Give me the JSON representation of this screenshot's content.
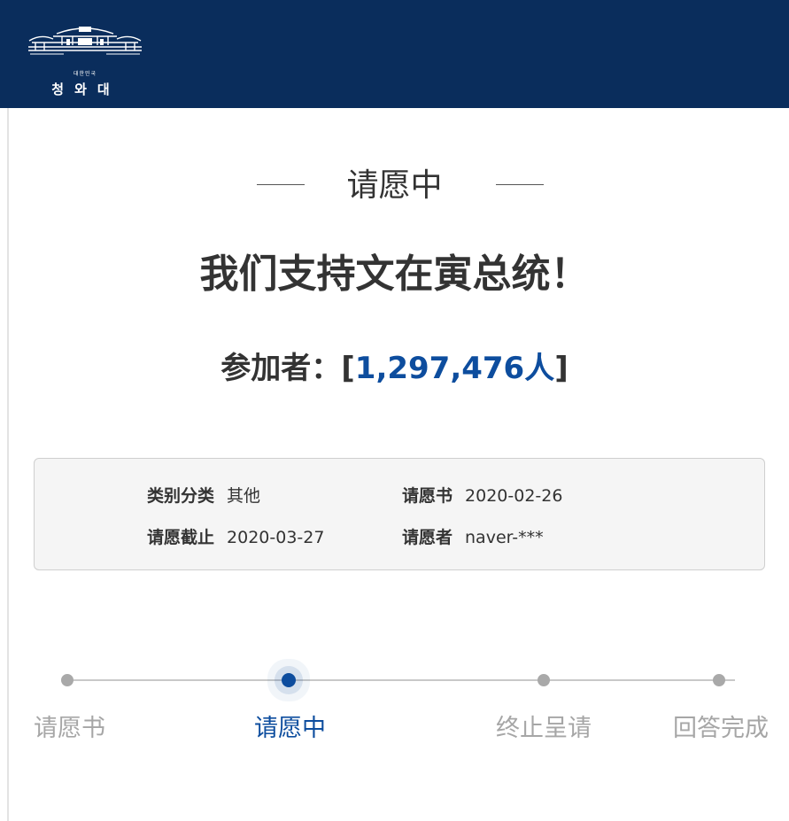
{
  "header": {
    "logo_small_text": "대한민국",
    "logo_main_text": "청와대"
  },
  "petition": {
    "status": "请愿中",
    "title": "我们支持文在寅总统！",
    "participants_prefix": "参加者：[",
    "participants_count": "1,297,476人",
    "participants_suffix": "]"
  },
  "info": {
    "category_label": "类别分类",
    "category_value": "其他",
    "start_label": "请愿书",
    "start_value": "2020-02-26",
    "end_label": "请愿截止",
    "end_value": "2020-03-27",
    "author_label": "请愿者",
    "author_value": "naver-***"
  },
  "progress": {
    "steps": [
      "请愿书",
      "请愿中",
      "终止呈请",
      "回答完成"
    ],
    "current_step": 2
  },
  "colors": {
    "header_bg": "#0a2d5c",
    "accent": "#0d4d9e",
    "inactive": "#a6a6a6"
  }
}
